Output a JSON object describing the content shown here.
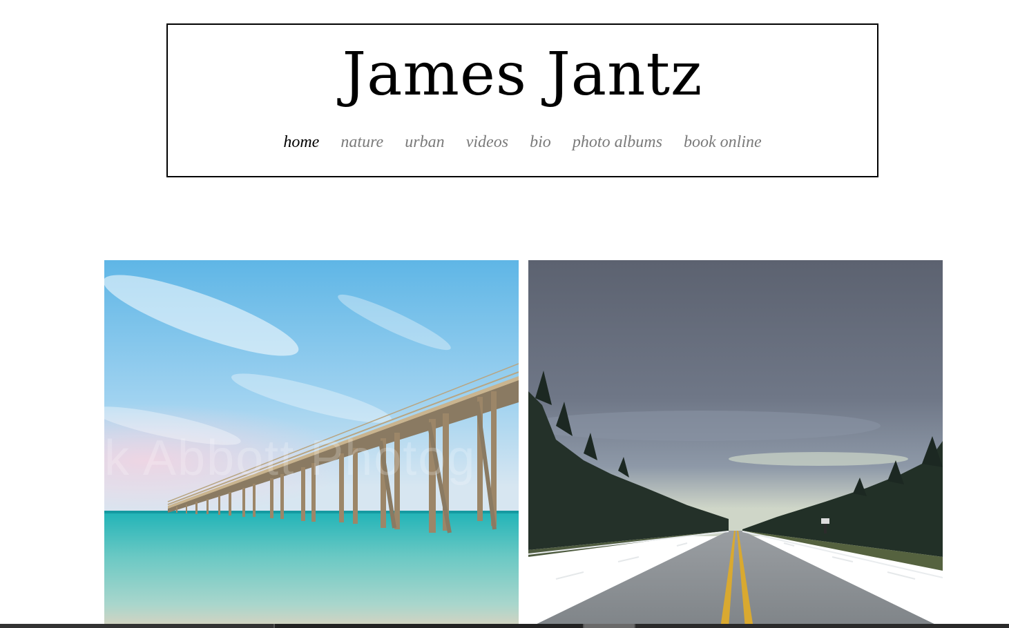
{
  "site": {
    "title": "James Jantz"
  },
  "nav": {
    "items": [
      {
        "label": "home",
        "active": true
      },
      {
        "label": "nature",
        "active": false
      },
      {
        "label": "urban",
        "active": false
      },
      {
        "label": "videos",
        "active": false
      },
      {
        "label": "bio",
        "active": false
      },
      {
        "label": "photo albums",
        "active": false
      },
      {
        "label": "book online",
        "active": false
      }
    ]
  },
  "gallery": {
    "photos": [
      {
        "subject": "pier-over-turquoise-sea",
        "watermark": "k Abbott Photog"
      },
      {
        "subject": "highway-through-forest"
      }
    ]
  },
  "colors": {
    "nav_active": "#000000",
    "nav_inactive": "#7a7a7a",
    "header_border": "#000000"
  }
}
